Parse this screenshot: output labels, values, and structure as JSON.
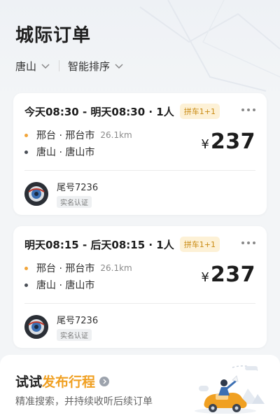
{
  "page": {
    "title": "城际订单"
  },
  "filters": {
    "city": "唐山",
    "sort": "智能排序"
  },
  "orders": [
    {
      "time": "今天08:30 - 明天08:30 · 1人",
      "badge": "拼车1+1",
      "from": "邢台 · 邢台市",
      "distance": "26.1km",
      "to": "唐山 · 唐山市",
      "currency": "¥",
      "price": "237",
      "plate": "尾号7236",
      "verify": "实名认证"
    },
    {
      "time": "明天08:15 - 后天08:15 · 1人",
      "badge": "拼车1+1",
      "from": "邢台 · 邢台市",
      "distance": "26.1km",
      "to": "唐山 · 唐山市",
      "currency": "¥",
      "price": "237",
      "plate": "尾号7236",
      "verify": "实名认证"
    }
  ],
  "promo": {
    "title_prefix": "试试",
    "title_highlight": "发布行程",
    "subtitle": "精准搜索，并持续收听后续订单"
  },
  "colors": {
    "accent": "#f0a022",
    "from_dot": "#f2a53a",
    "to_dot": "#4a4f57",
    "badge_text": "#c98a12",
    "badge_bg": "#fdf1d6"
  },
  "icons": {
    "chevron": "chevron-down-icon",
    "more": "more-dots-icon",
    "arrow": "chevron-right-circle-icon"
  }
}
